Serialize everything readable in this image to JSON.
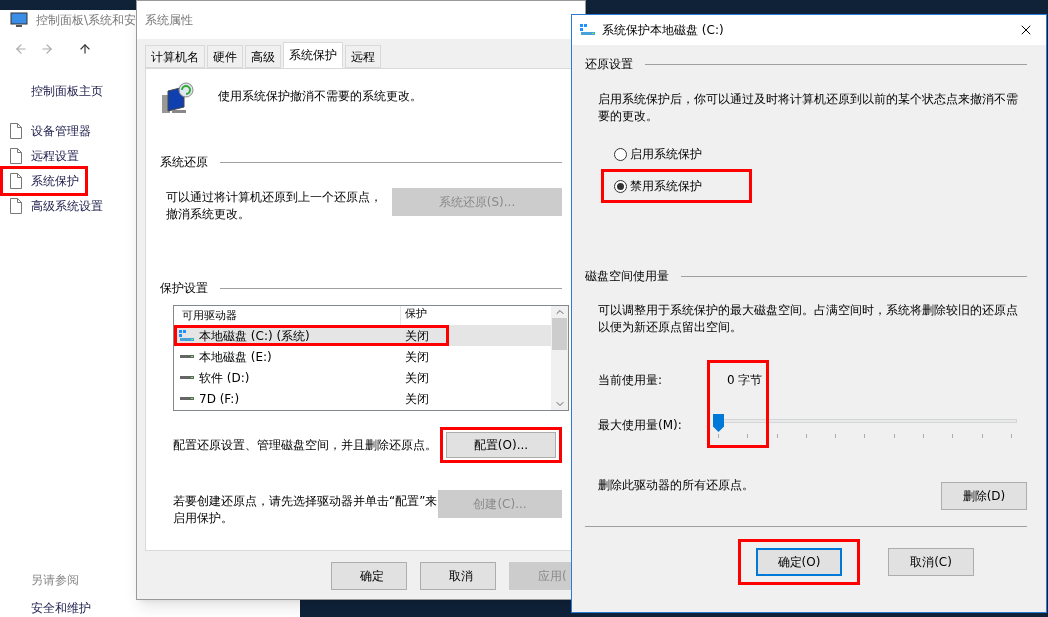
{
  "back_window": {
    "title": "控制面板\\系统和安",
    "sidebar": {
      "home": "控制面板主页",
      "items": [
        {
          "label": "设备管理器",
          "highlighted": false
        },
        {
          "label": "远程设置",
          "highlighted": false
        },
        {
          "label": "系统保护",
          "highlighted": true
        },
        {
          "label": "高级系统设置",
          "highlighted": false
        }
      ],
      "see_also_heading": "另请参阅",
      "see_also": [
        "安全和维护"
      ]
    }
  },
  "properties_dialog": {
    "title": "系统属性",
    "tabs": [
      {
        "label": "计算机名",
        "selected": false
      },
      {
        "label": "硬件",
        "selected": false
      },
      {
        "label": "高级",
        "selected": false
      },
      {
        "label": "系统保护",
        "selected": true
      },
      {
        "label": "远程",
        "selected": false
      }
    ],
    "intro": "使用系统保护撤消不需要的系统更改。",
    "restore_group": {
      "heading": "系统还原",
      "text": "可以通过将计算机还原到上一个还原点，撤消系统更改。",
      "button": {
        "label": "系统还原(S)...",
        "disabled": true
      }
    },
    "protection_group": {
      "heading": "保护设置",
      "columns": [
        "可用驱动器",
        "保护"
      ],
      "rows": [
        {
          "drive": "本地磁盘 (C:) (系统)",
          "protection": "关闭",
          "kind": "system",
          "selected": true,
          "highlighted": true
        },
        {
          "drive": "本地磁盘 (E:)",
          "protection": "关闭",
          "kind": "disk",
          "selected": false,
          "highlighted": false
        },
        {
          "drive": "软件 (D:)",
          "protection": "关闭",
          "kind": "disk",
          "selected": false,
          "highlighted": false
        },
        {
          "drive": "7D (F:)",
          "protection": "关闭",
          "kind": "disk",
          "selected": false,
          "highlighted": false
        }
      ],
      "configure_text": "配置还原设置、管理磁盘空间，并且删除还原点。",
      "configure_button": {
        "label": "配置(O)...",
        "disabled": false,
        "highlighted": true
      },
      "create_text": "若要创建还原点，请先选择驱动器并单击“配置”来启用保护。",
      "create_button": {
        "label": "创建(C)...",
        "disabled": true
      }
    },
    "buttons": [
      {
        "label": "确定",
        "disabled": false
      },
      {
        "label": "取消",
        "disabled": false
      },
      {
        "label": "应用(",
        "disabled": true
      }
    ]
  },
  "drive_dialog": {
    "title": "系统保护本地磁盘 (C:)",
    "restore_heading": "还原设置",
    "restore_text": "启用系统保护后，你可以通过及时将计算机还原到以前的某个状态点来撤消不需要的更改。",
    "radios": [
      {
        "label": "启用系统保护",
        "selected": false,
        "highlighted": false
      },
      {
        "label": "禁用系统保护",
        "selected": true,
        "highlighted": true
      }
    ],
    "usage_heading": "磁盘空间使用量",
    "usage_text": "可以调整用于系统保护的最大磁盘空间。占满空间时，系统将删除较旧的还原点以便为新还原点留出空间。",
    "current_label": "当前使用量:",
    "current_value": "0 字节",
    "max_label": "最大使用量(M):",
    "max_slider": {
      "level": 0,
      "highlighted": true
    },
    "delete_text": "删除此驱动器的所有还原点。",
    "delete_button": "删除(D)",
    "buttons": [
      {
        "label": "确定(O)",
        "default": true,
        "highlighted": true
      },
      {
        "label": "取消(C)",
        "default": false,
        "highlighted": false
      }
    ]
  }
}
